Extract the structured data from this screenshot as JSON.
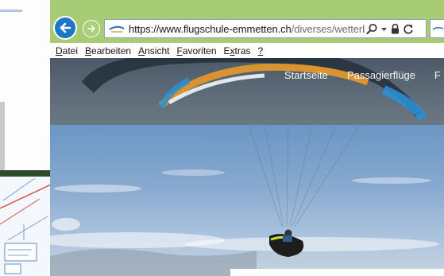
{
  "browser": {
    "url_host": "https://www.flugschule-emmetten.ch",
    "url_path": "/diverses/wetterbrie"
  },
  "menubar": {
    "items": [
      {
        "pre": "",
        "accel": "D",
        "rest": "atei"
      },
      {
        "pre": "",
        "accel": "B",
        "rest": "earbeiten"
      },
      {
        "pre": "",
        "accel": "A",
        "rest": "nsicht"
      },
      {
        "pre": "",
        "accel": "F",
        "rest": "avoriten"
      },
      {
        "pre": "E",
        "accel": "x",
        "rest": "tras"
      },
      {
        "pre": "",
        "accel": "?",
        "rest": ""
      }
    ]
  },
  "site": {
    "nav": [
      "Startseite",
      "Passagierflüge",
      "F"
    ]
  },
  "colors": {
    "toolbar": "#a8cc76",
    "back_button": "#1f75c6",
    "hero": "#5d6c78",
    "sky": "#86a9cf",
    "wing_orange": "#e8992a",
    "wing_blue": "#2c8fd0"
  }
}
